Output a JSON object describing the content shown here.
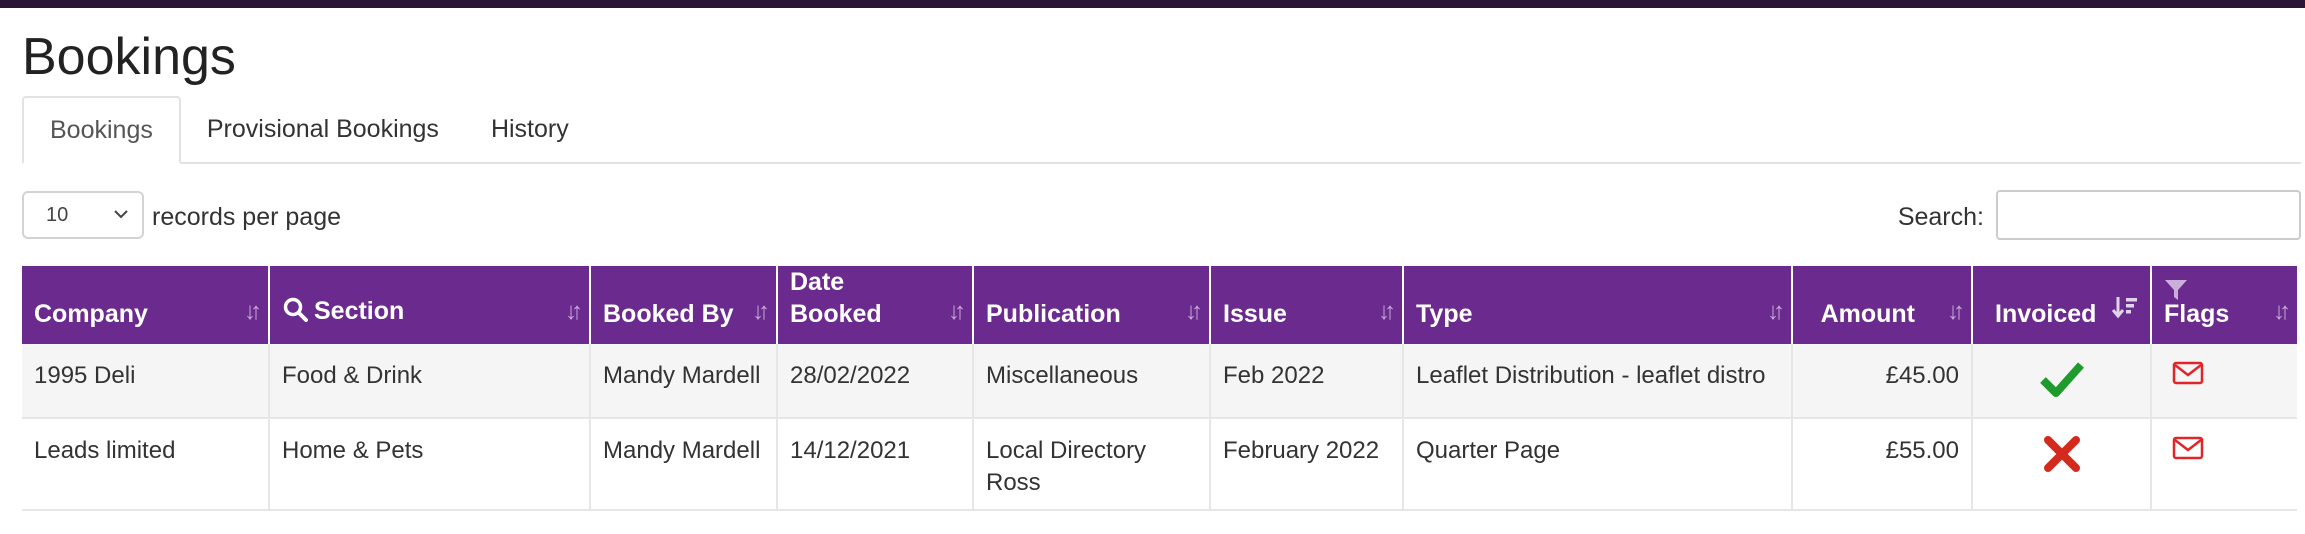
{
  "page": {
    "title": "Bookings"
  },
  "tabs": [
    {
      "label": "Bookings",
      "active": true
    },
    {
      "label": "Provisional Bookings",
      "active": false
    },
    {
      "label": "History",
      "active": false
    }
  ],
  "length_control": {
    "value": "10",
    "suffix": "records per page"
  },
  "search": {
    "label": "Search:",
    "value": ""
  },
  "colors": {
    "header_bg": "#6b2a8e",
    "top_bar": "#2b1438",
    "check": "#1e9b2c",
    "cross": "#d42a1e",
    "flag": "#e0262b"
  },
  "table": {
    "columns": [
      {
        "label": "Company"
      },
      {
        "label": "Section",
        "icon": "search-icon"
      },
      {
        "label": "Booked By"
      },
      {
        "label": "Date Booked"
      },
      {
        "label": "Publication"
      },
      {
        "label": "Issue"
      },
      {
        "label": "Type"
      },
      {
        "label": "Amount"
      },
      {
        "label": "Invoiced",
        "sorted": "desc"
      },
      {
        "label": "Flags",
        "icon": "filter-icon"
      }
    ],
    "rows": [
      {
        "company": "1995 Deli",
        "section": "Food & Drink",
        "booked_by": "Mandy Mardell",
        "date_booked": "28/02/2022",
        "publication": "Miscellaneous",
        "issue": "Feb 2022",
        "type": "Leaflet Distribution - leaflet distro",
        "amount": "£45.00",
        "invoiced": "check-icon",
        "flags": "envelope-icon"
      },
      {
        "company": "Leads limited",
        "section": "Home & Pets",
        "booked_by": "Mandy Mardell",
        "date_booked": "14/12/2021",
        "publication": "Local Directory Ross",
        "issue": "February 2022",
        "type": "Quarter Page",
        "amount": "£55.00",
        "invoiced": "cross-icon",
        "flags": "envelope-icon"
      }
    ]
  }
}
